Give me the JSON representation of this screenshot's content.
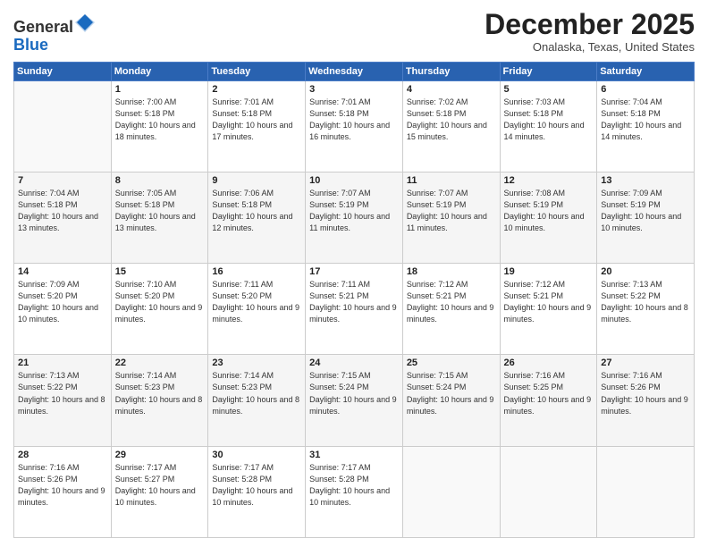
{
  "logo": {
    "general": "General",
    "blue": "Blue"
  },
  "header": {
    "month": "December 2025",
    "location": "Onalaska, Texas, United States"
  },
  "weekdays": [
    "Sunday",
    "Monday",
    "Tuesday",
    "Wednesday",
    "Thursday",
    "Friday",
    "Saturday"
  ],
  "weeks": [
    [
      {
        "day": "",
        "sunrise": "",
        "sunset": "",
        "daylight": ""
      },
      {
        "day": "1",
        "sunrise": "Sunrise: 7:00 AM",
        "sunset": "Sunset: 5:18 PM",
        "daylight": "Daylight: 10 hours and 18 minutes."
      },
      {
        "day": "2",
        "sunrise": "Sunrise: 7:01 AM",
        "sunset": "Sunset: 5:18 PM",
        "daylight": "Daylight: 10 hours and 17 minutes."
      },
      {
        "day": "3",
        "sunrise": "Sunrise: 7:01 AM",
        "sunset": "Sunset: 5:18 PM",
        "daylight": "Daylight: 10 hours and 16 minutes."
      },
      {
        "day": "4",
        "sunrise": "Sunrise: 7:02 AM",
        "sunset": "Sunset: 5:18 PM",
        "daylight": "Daylight: 10 hours and 15 minutes."
      },
      {
        "day": "5",
        "sunrise": "Sunrise: 7:03 AM",
        "sunset": "Sunset: 5:18 PM",
        "daylight": "Daylight: 10 hours and 14 minutes."
      },
      {
        "day": "6",
        "sunrise": "Sunrise: 7:04 AM",
        "sunset": "Sunset: 5:18 PM",
        "daylight": "Daylight: 10 hours and 14 minutes."
      }
    ],
    [
      {
        "day": "7",
        "sunrise": "Sunrise: 7:04 AM",
        "sunset": "Sunset: 5:18 PM",
        "daylight": "Daylight: 10 hours and 13 minutes."
      },
      {
        "day": "8",
        "sunrise": "Sunrise: 7:05 AM",
        "sunset": "Sunset: 5:18 PM",
        "daylight": "Daylight: 10 hours and 13 minutes."
      },
      {
        "day": "9",
        "sunrise": "Sunrise: 7:06 AM",
        "sunset": "Sunset: 5:18 PM",
        "daylight": "Daylight: 10 hours and 12 minutes."
      },
      {
        "day": "10",
        "sunrise": "Sunrise: 7:07 AM",
        "sunset": "Sunset: 5:19 PM",
        "daylight": "Daylight: 10 hours and 11 minutes."
      },
      {
        "day": "11",
        "sunrise": "Sunrise: 7:07 AM",
        "sunset": "Sunset: 5:19 PM",
        "daylight": "Daylight: 10 hours and 11 minutes."
      },
      {
        "day": "12",
        "sunrise": "Sunrise: 7:08 AM",
        "sunset": "Sunset: 5:19 PM",
        "daylight": "Daylight: 10 hours and 10 minutes."
      },
      {
        "day": "13",
        "sunrise": "Sunrise: 7:09 AM",
        "sunset": "Sunset: 5:19 PM",
        "daylight": "Daylight: 10 hours and 10 minutes."
      }
    ],
    [
      {
        "day": "14",
        "sunrise": "Sunrise: 7:09 AM",
        "sunset": "Sunset: 5:20 PM",
        "daylight": "Daylight: 10 hours and 10 minutes."
      },
      {
        "day": "15",
        "sunrise": "Sunrise: 7:10 AM",
        "sunset": "Sunset: 5:20 PM",
        "daylight": "Daylight: 10 hours and 9 minutes."
      },
      {
        "day": "16",
        "sunrise": "Sunrise: 7:11 AM",
        "sunset": "Sunset: 5:20 PM",
        "daylight": "Daylight: 10 hours and 9 minutes."
      },
      {
        "day": "17",
        "sunrise": "Sunrise: 7:11 AM",
        "sunset": "Sunset: 5:21 PM",
        "daylight": "Daylight: 10 hours and 9 minutes."
      },
      {
        "day": "18",
        "sunrise": "Sunrise: 7:12 AM",
        "sunset": "Sunset: 5:21 PM",
        "daylight": "Daylight: 10 hours and 9 minutes."
      },
      {
        "day": "19",
        "sunrise": "Sunrise: 7:12 AM",
        "sunset": "Sunset: 5:21 PM",
        "daylight": "Daylight: 10 hours and 9 minutes."
      },
      {
        "day": "20",
        "sunrise": "Sunrise: 7:13 AM",
        "sunset": "Sunset: 5:22 PM",
        "daylight": "Daylight: 10 hours and 8 minutes."
      }
    ],
    [
      {
        "day": "21",
        "sunrise": "Sunrise: 7:13 AM",
        "sunset": "Sunset: 5:22 PM",
        "daylight": "Daylight: 10 hours and 8 minutes."
      },
      {
        "day": "22",
        "sunrise": "Sunrise: 7:14 AM",
        "sunset": "Sunset: 5:23 PM",
        "daylight": "Daylight: 10 hours and 8 minutes."
      },
      {
        "day": "23",
        "sunrise": "Sunrise: 7:14 AM",
        "sunset": "Sunset: 5:23 PM",
        "daylight": "Daylight: 10 hours and 8 minutes."
      },
      {
        "day": "24",
        "sunrise": "Sunrise: 7:15 AM",
        "sunset": "Sunset: 5:24 PM",
        "daylight": "Daylight: 10 hours and 9 minutes."
      },
      {
        "day": "25",
        "sunrise": "Sunrise: 7:15 AM",
        "sunset": "Sunset: 5:24 PM",
        "daylight": "Daylight: 10 hours and 9 minutes."
      },
      {
        "day": "26",
        "sunrise": "Sunrise: 7:16 AM",
        "sunset": "Sunset: 5:25 PM",
        "daylight": "Daylight: 10 hours and 9 minutes."
      },
      {
        "day": "27",
        "sunrise": "Sunrise: 7:16 AM",
        "sunset": "Sunset: 5:26 PM",
        "daylight": "Daylight: 10 hours and 9 minutes."
      }
    ],
    [
      {
        "day": "28",
        "sunrise": "Sunrise: 7:16 AM",
        "sunset": "Sunset: 5:26 PM",
        "daylight": "Daylight: 10 hours and 9 minutes."
      },
      {
        "day": "29",
        "sunrise": "Sunrise: 7:17 AM",
        "sunset": "Sunset: 5:27 PM",
        "daylight": "Daylight: 10 hours and 10 minutes."
      },
      {
        "day": "30",
        "sunrise": "Sunrise: 7:17 AM",
        "sunset": "Sunset: 5:28 PM",
        "daylight": "Daylight: 10 hours and 10 minutes."
      },
      {
        "day": "31",
        "sunrise": "Sunrise: 7:17 AM",
        "sunset": "Sunset: 5:28 PM",
        "daylight": "Daylight: 10 hours and 10 minutes."
      },
      {
        "day": "",
        "sunrise": "",
        "sunset": "",
        "daylight": ""
      },
      {
        "day": "",
        "sunrise": "",
        "sunset": "",
        "daylight": ""
      },
      {
        "day": "",
        "sunrise": "",
        "sunset": "",
        "daylight": ""
      }
    ]
  ]
}
